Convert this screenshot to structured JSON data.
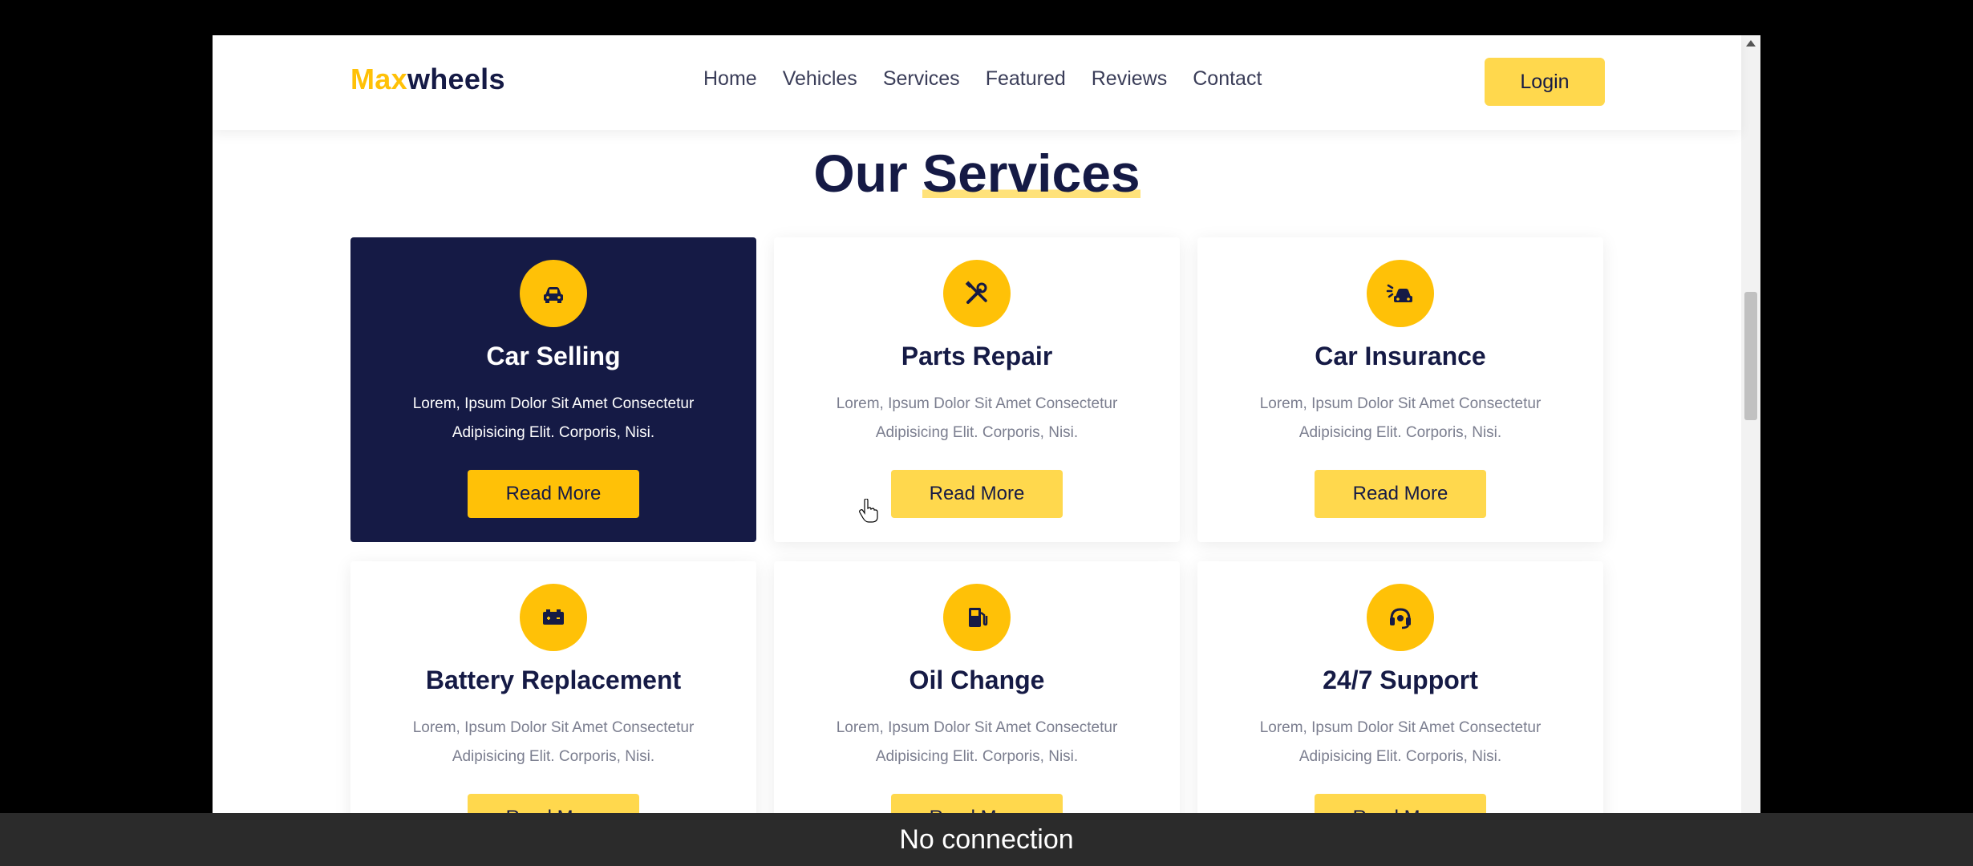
{
  "header": {
    "logo_accent": "Max",
    "logo_rest": "wheels",
    "nav": [
      "Home",
      "Vehicles",
      "Services",
      "Featured",
      "Reviews",
      "Contact"
    ],
    "login_label": "Login"
  },
  "section": {
    "title_part1": "Our ",
    "title_part2": "Services"
  },
  "services": [
    {
      "title": "Car Selling",
      "desc": "Lorem, Ipsum Dolor Sit Amet Consectetur Adipisicing Elit. Corporis, Nisi.",
      "button": "Read More",
      "icon": "car-icon"
    },
    {
      "title": "Parts Repair",
      "desc": "Lorem, Ipsum Dolor Sit Amet Consectetur Adipisicing Elit. Corporis, Nisi.",
      "button": "Read More",
      "icon": "tools-icon"
    },
    {
      "title": "Car Insurance",
      "desc": "Lorem, Ipsum Dolor Sit Amet Consectetur Adipisicing Elit. Corporis, Nisi.",
      "button": "Read More",
      "icon": "car-crash-icon"
    },
    {
      "title": "Battery Replacement",
      "desc": "Lorem, Ipsum Dolor Sit Amet Consectetur Adipisicing Elit. Corporis, Nisi.",
      "button": "Read More",
      "icon": "battery-icon"
    },
    {
      "title": "Oil Change",
      "desc": "Lorem, Ipsum Dolor Sit Amet Consectetur Adipisicing Elit. Corporis, Nisi.",
      "button": "Read More",
      "icon": "gas-pump-icon"
    },
    {
      "title": "24/7 Support",
      "desc": "Lorem, Ipsum Dolor Sit Amet Consectetur Adipisicing Elit. Corporis, Nisi.",
      "button": "Read More",
      "icon": "headset-icon"
    }
  ],
  "toast": {
    "message": "No connection"
  },
  "colors": {
    "accent": "#ffc107",
    "navy": "#151a45",
    "button": "#ffd84d"
  }
}
